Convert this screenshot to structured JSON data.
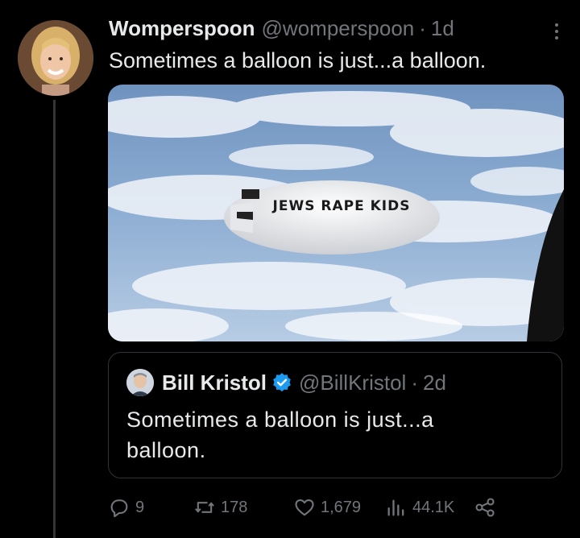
{
  "tweet": {
    "display_name": "Womperspoon",
    "handle": "@womperspoon",
    "separator": "·",
    "time": "1d",
    "text": "Sometimes a balloon is just...a balloon.",
    "image_text": "JEWS RAPE KIDS"
  },
  "quoted": {
    "display_name": "Bill Kristol",
    "handle": "@BillKristol",
    "separator": "·",
    "time": "2d",
    "text": "Sometimes a balloon is just...a balloon."
  },
  "actions": {
    "replies": "9",
    "retweets": "178",
    "likes": "1,679",
    "views": "44.1K"
  },
  "icons": {
    "more": "more-icon",
    "reply": "reply-icon",
    "retweet": "retweet-icon",
    "like": "heart-icon",
    "views": "views-icon",
    "share": "share-icon",
    "verified": "verified-badge-icon"
  },
  "colors": {
    "background": "#000000",
    "text": "#e7e9ea",
    "muted": "#71767b",
    "verified": "#1d9bf0",
    "border": "#2f3336"
  }
}
